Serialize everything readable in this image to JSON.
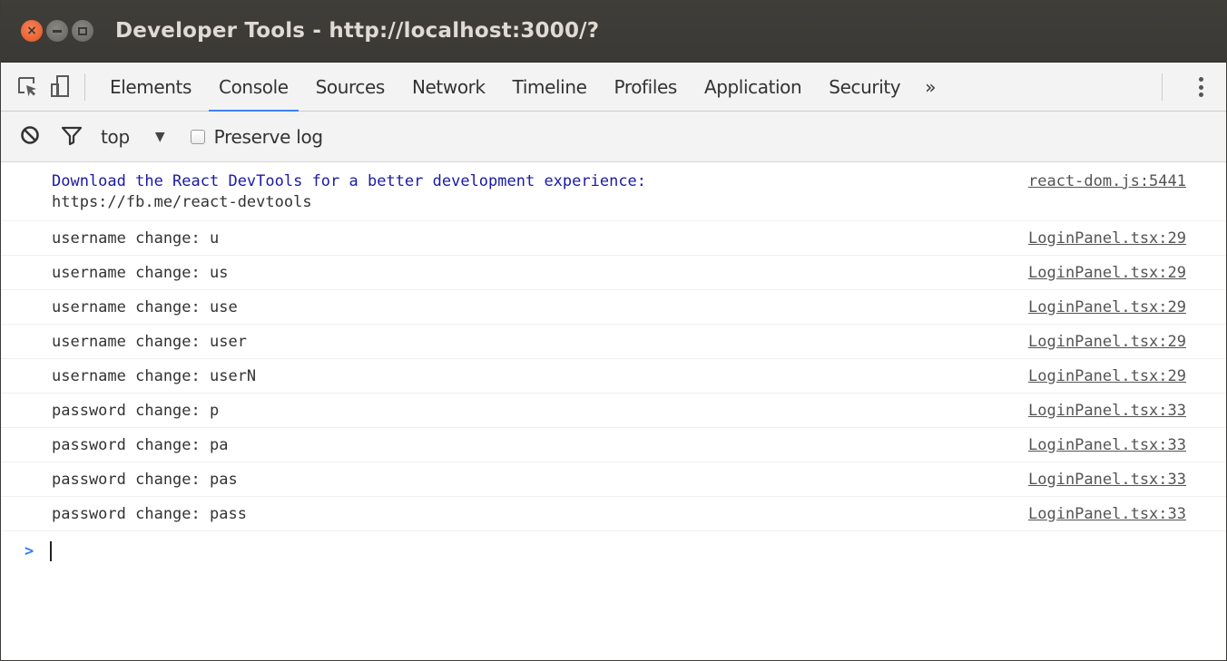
{
  "window": {
    "title": "Developer Tools - http://localhost:3000/?",
    "controls": [
      {
        "name": "close",
        "icon": "close-icon",
        "glyph": "×"
      },
      {
        "name": "minimize",
        "icon": "minimize-icon"
      },
      {
        "name": "maximize",
        "icon": "maximize-icon"
      }
    ]
  },
  "toolbar": {
    "inspect_icon": "inspect-element-icon",
    "device_icon": "device-mode-icon",
    "tabs": [
      {
        "label": "Elements",
        "active": false
      },
      {
        "label": "Console",
        "active": true
      },
      {
        "label": "Sources",
        "active": false
      },
      {
        "label": "Network",
        "active": false
      },
      {
        "label": "Timeline",
        "active": false
      },
      {
        "label": "Profiles",
        "active": false
      },
      {
        "label": "Application",
        "active": false
      },
      {
        "label": "Security",
        "active": false
      }
    ],
    "overflow_label": "»",
    "menu_icon": "kebab-menu-icon",
    "accent_color": "#3e82f7"
  },
  "console_toolbar": {
    "clear_icon": "clear-console-icon",
    "filter_icon": "filter-icon",
    "context": "top",
    "context_arrow": "▼",
    "preserve_log_label": "Preserve log",
    "preserve_log_checked": false
  },
  "messages": [
    {
      "text": "Download the React DevTools for a better development experience:",
      "sub": "https://fb.me/react-devtools",
      "source": "react-dom.js:5441",
      "color": "#1a1aa6"
    },
    {
      "text": "username change: u",
      "source": "LoginPanel.tsx:29"
    },
    {
      "text": "username change: us",
      "source": "LoginPanel.tsx:29"
    },
    {
      "text": "username change: use",
      "source": "LoginPanel.tsx:29"
    },
    {
      "text": "username change: user",
      "source": "LoginPanel.tsx:29"
    },
    {
      "text": "username change: userN",
      "source": "LoginPanel.tsx:29"
    },
    {
      "text": "password change: p",
      "source": "LoginPanel.tsx:33"
    },
    {
      "text": "password change: pa",
      "source": "LoginPanel.tsx:33"
    },
    {
      "text": "password change: pas",
      "source": "LoginPanel.tsx:33"
    },
    {
      "text": "password change: pass",
      "source": "LoginPanel.tsx:33"
    }
  ],
  "prompt": {
    "symbol": ">",
    "value": ""
  }
}
